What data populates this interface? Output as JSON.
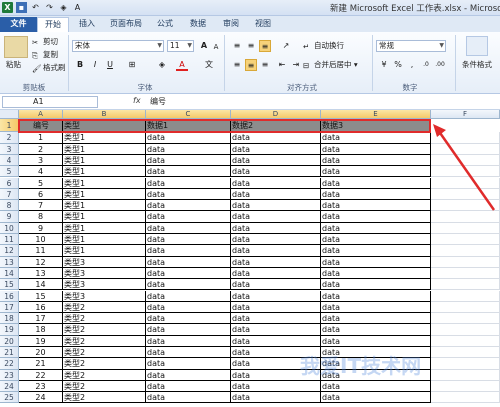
{
  "window": {
    "title": "新建 Microsoft Excel 工作表.xlsx - Microsoft E"
  },
  "tabs": [
    {
      "label": "文件"
    },
    {
      "label": "开始"
    },
    {
      "label": "插入"
    },
    {
      "label": "页面布局"
    },
    {
      "label": "公式"
    },
    {
      "label": "数据"
    },
    {
      "label": "审阅"
    },
    {
      "label": "视图"
    }
  ],
  "ribbon": {
    "clipboard": {
      "paste_label": "粘贴",
      "cut_label": "剪切",
      "copy_label": "复制",
      "format_painter_label": "格式刷",
      "group_label": "剪贴板"
    },
    "font": {
      "font_name": "宋体",
      "font_size": "11",
      "group_label": "字体",
      "bold": "B",
      "italic": "I",
      "underline": "U",
      "font_color_letter": "A",
      "grow": "A",
      "shrink": "A"
    },
    "alignment": {
      "wrap_text_label": "自动换行",
      "merge_center_label": "合并后居中",
      "group_label": "对齐方式"
    },
    "number": {
      "format_value": "常规",
      "group_label": "数字",
      "percent": "%",
      "comma": ","
    },
    "styles": {
      "conditional_format_label": "条件格式"
    }
  },
  "formula_bar": {
    "name_box": "A1",
    "fx_label": "fx",
    "value": "编号"
  },
  "sheet": {
    "columns": [
      "A",
      "B",
      "C",
      "D",
      "E",
      "F"
    ],
    "selected_row": "1",
    "header": [
      "编号",
      "类型",
      "数据1",
      "数据2",
      "数据3"
    ],
    "rows": [
      {
        "row": "2",
        "id": "1",
        "type": "类型1",
        "d1": "data",
        "d2": "data",
        "d3": "data"
      },
      {
        "row": "3",
        "id": "2",
        "type": "类型1",
        "d1": "data",
        "d2": "data",
        "d3": "data"
      },
      {
        "row": "4",
        "id": "3",
        "type": "类型1",
        "d1": "data",
        "d2": "data",
        "d3": "data"
      },
      {
        "row": "5",
        "id": "4",
        "type": "类型1",
        "d1": "data",
        "d2": "data",
        "d3": "data"
      },
      {
        "row": "6",
        "id": "5",
        "type": "类型1",
        "d1": "data",
        "d2": "data",
        "d3": "data"
      },
      {
        "row": "7",
        "id": "6",
        "type": "类型1",
        "d1": "data",
        "d2": "data",
        "d3": "data"
      },
      {
        "row": "8",
        "id": "7",
        "type": "类型1",
        "d1": "data",
        "d2": "data",
        "d3": "data"
      },
      {
        "row": "9",
        "id": "8",
        "type": "类型1",
        "d1": "data",
        "d2": "data",
        "d3": "data"
      },
      {
        "row": "10",
        "id": "9",
        "type": "类型1",
        "d1": "data",
        "d2": "data",
        "d3": "data"
      },
      {
        "row": "11",
        "id": "10",
        "type": "类型1",
        "d1": "data",
        "d2": "data",
        "d3": "data"
      },
      {
        "row": "12",
        "id": "11",
        "type": "类型1",
        "d1": "data",
        "d2": "data",
        "d3": "data"
      },
      {
        "row": "13",
        "id": "12",
        "type": "类型3",
        "d1": "data",
        "d2": "data",
        "d3": "data"
      },
      {
        "row": "14",
        "id": "13",
        "type": "类型3",
        "d1": "data",
        "d2": "data",
        "d3": "data"
      },
      {
        "row": "15",
        "id": "14",
        "type": "类型3",
        "d1": "data",
        "d2": "data",
        "d3": "data"
      },
      {
        "row": "16",
        "id": "15",
        "type": "类型3",
        "d1": "data",
        "d2": "data",
        "d3": "data"
      },
      {
        "row": "17",
        "id": "16",
        "type": "类型2",
        "d1": "data",
        "d2": "data",
        "d3": "data"
      },
      {
        "row": "18",
        "id": "17",
        "type": "类型2",
        "d1": "data",
        "d2": "data",
        "d3": "data"
      },
      {
        "row": "19",
        "id": "18",
        "type": "类型2",
        "d1": "data",
        "d2": "data",
        "d3": "data"
      },
      {
        "row": "20",
        "id": "19",
        "type": "类型2",
        "d1": "data",
        "d2": "data",
        "d3": "data"
      },
      {
        "row": "21",
        "id": "20",
        "type": "类型2",
        "d1": "data",
        "d2": "data",
        "d3": "data"
      },
      {
        "row": "22",
        "id": "21",
        "type": "类型2",
        "d1": "data",
        "d2": "data",
        "d3": "data"
      },
      {
        "row": "23",
        "id": "22",
        "type": "类型2",
        "d1": "data",
        "d2": "data",
        "d3": "data"
      },
      {
        "row": "24",
        "id": "23",
        "type": "类型2",
        "d1": "data",
        "d2": "data",
        "d3": "data"
      },
      {
        "row": "25",
        "id": "24",
        "type": "类型2",
        "d1": "data",
        "d2": "data",
        "d3": "data"
      }
    ]
  },
  "colors": {
    "header_fill": "#8c8c8c",
    "highlight": "#e02b2b",
    "file_tab": "#2a5ea8"
  },
  "watermark": "我爱IT技术网"
}
